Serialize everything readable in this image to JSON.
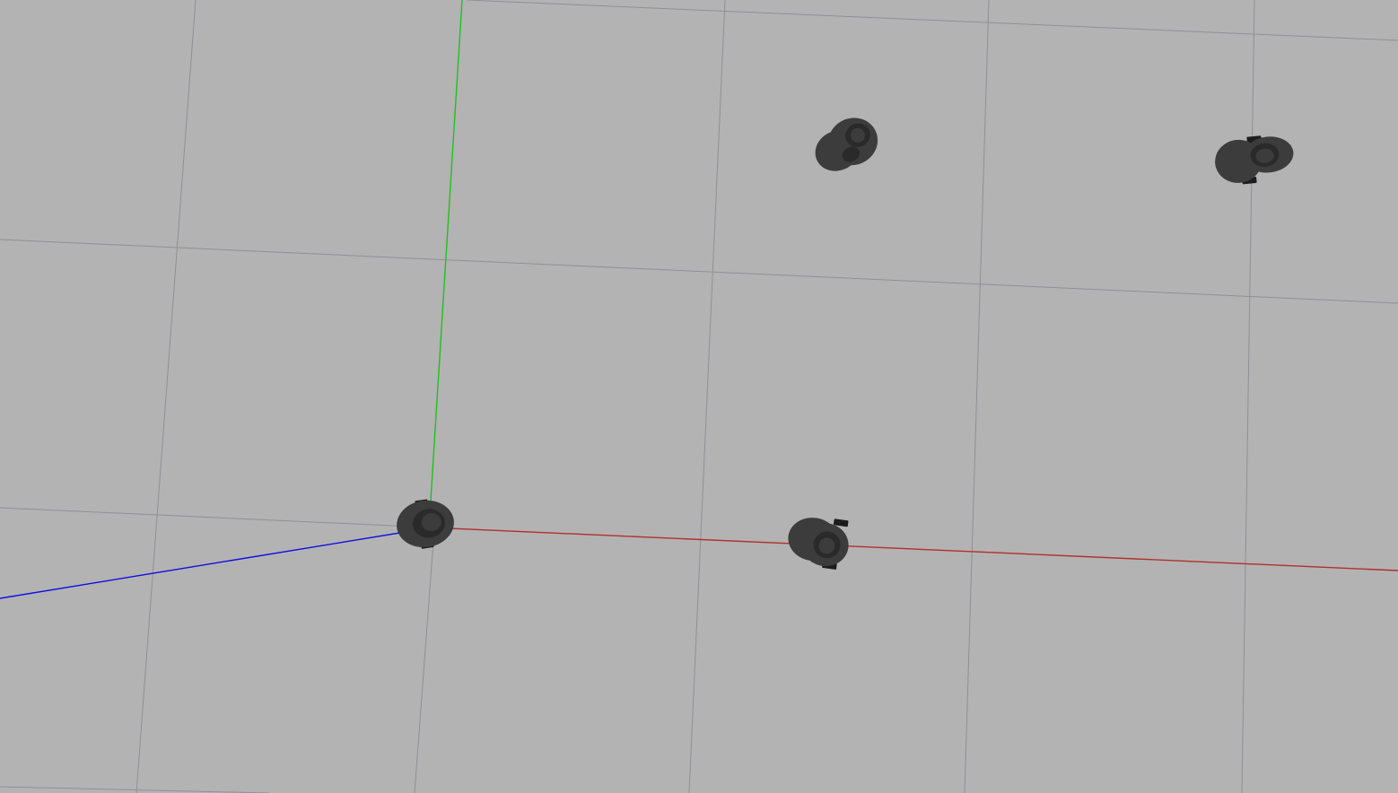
{
  "scene": {
    "background_color": "#b3b3b3",
    "grid_color": "#8f8f98",
    "axes": {
      "x": {
        "color": "#b03030"
      },
      "y": {
        "color": "#20c020"
      },
      "z": {
        "color": "#1010e0"
      }
    },
    "robots": [
      {
        "id": "robot-at-origin",
        "icon": "turtlebot-robot-icon"
      },
      {
        "id": "robot-on-x-axis",
        "icon": "turtlebot-robot-icon"
      },
      {
        "id": "robot-upper-center",
        "icon": "turtlebot-robot-icon"
      },
      {
        "id": "robot-upper-right",
        "icon": "turtlebot-robot-icon"
      }
    ],
    "robot_body_color": "#3c3c3c",
    "robot_shadow_color": "#2a2a2a",
    "robot_wheel_color": "#1c1c1c"
  }
}
